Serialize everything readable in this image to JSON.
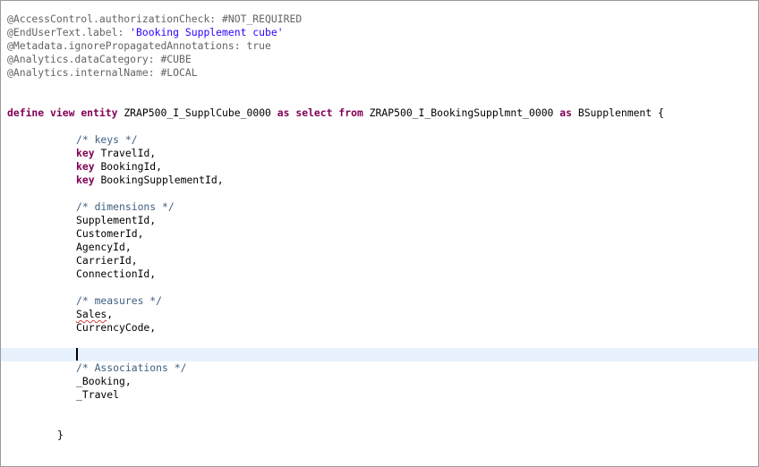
{
  "editor": {
    "annotations": [
      "@AccessControl.authorizationCheck: #NOT_REQUIRED",
      "@EndUserText.label: ",
      "@Metadata.ignorePropagatedAnnotations: true",
      "@Analytics.dataCategory: #CUBE",
      "@Analytics.internalName: #LOCAL"
    ],
    "label_string": "'Booking Supplement cube'",
    "define": {
      "kw_define": "define",
      "kw_view": "view",
      "kw_entity": "entity",
      "view_name": "ZRAP500_I_SupplCube_0000",
      "kw_as": "as",
      "kw_select": "select",
      "kw_from": "from",
      "source": "ZRAP500_I_BookingSupplmnt_0000",
      "kw_as2": "as",
      "alias": "BSupplenment {"
    },
    "keys_comment": "/* keys */",
    "key_kw": "key",
    "keys": [
      "TravelId,",
      "BookingId,",
      "BookingSupplementId,"
    ],
    "dimensions_comment": "/* dimensions */",
    "dimensions": [
      "SupplementId,",
      "CustomerId,",
      "AgencyId,",
      "CarrierId,",
      "ConnectionId,"
    ],
    "measures_comment": "/* measures */",
    "measures": [
      "Sales",
      ",",
      "CurrencyCode,"
    ],
    "associations_comment": "/* Associations */",
    "associations": [
      "_Booking,",
      "_Travel"
    ],
    "closing": "}"
  }
}
